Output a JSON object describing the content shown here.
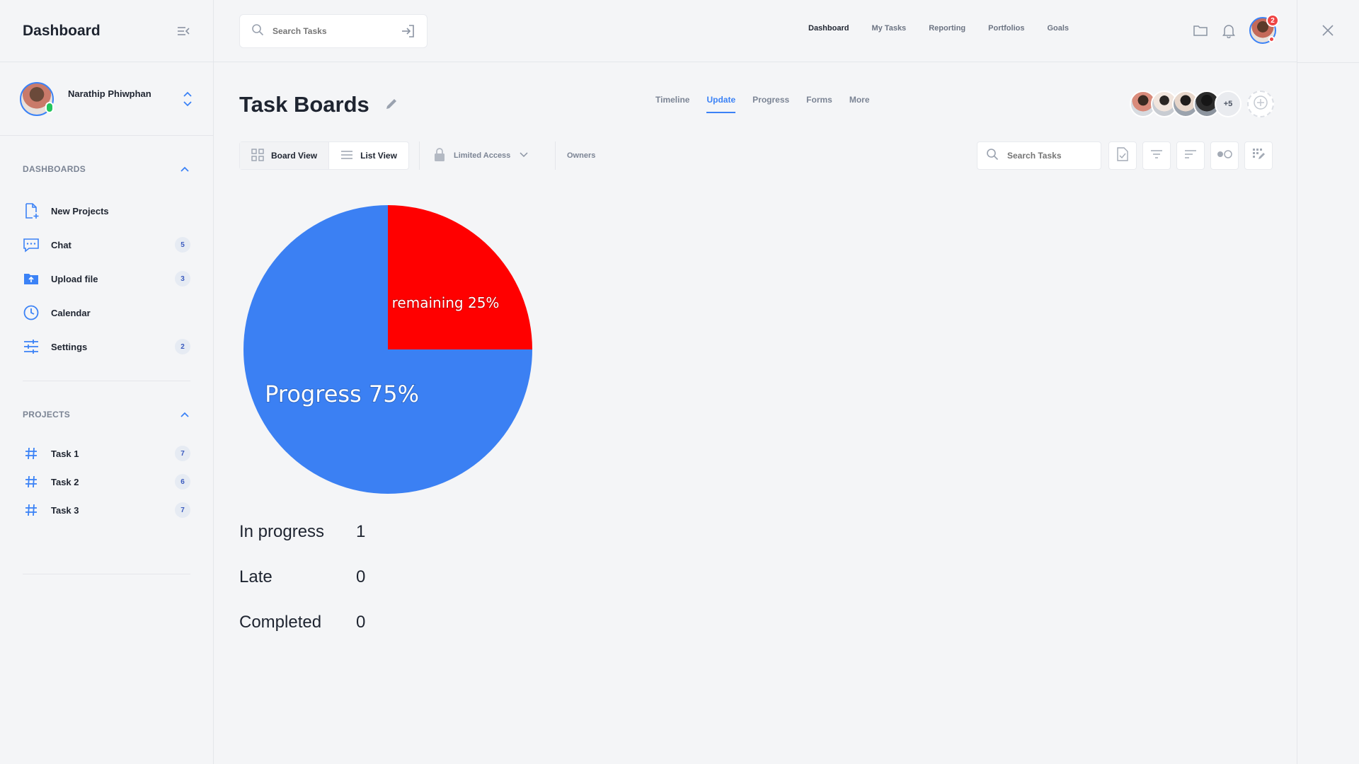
{
  "sidebar": {
    "title": "Dashboard",
    "user": {
      "name": "Narathip Phiwphan"
    },
    "dashboards": {
      "title": "DASHBOARDS",
      "items": [
        {
          "label": "New Projects",
          "badge": ""
        },
        {
          "label": "Chat",
          "badge": "5"
        },
        {
          "label": "Upload file",
          "badge": "3"
        },
        {
          "label": "Calendar",
          "badge": ""
        },
        {
          "label": "Settings",
          "badge": "2"
        }
      ]
    },
    "projects": {
      "title": "PROJECTS",
      "items": [
        {
          "label": "Task 1",
          "badge": "7"
        },
        {
          "label": "Task 2",
          "badge": "6"
        },
        {
          "label": "Task 3",
          "badge": "7"
        }
      ]
    }
  },
  "topbar": {
    "search_placeholder": "Search Tasks",
    "nav": [
      "Dashboard",
      "My Tasks",
      "Reporting",
      "Portfolios",
      "Goals"
    ],
    "notification_count": "2"
  },
  "main": {
    "title": "Task Boards",
    "tabs": [
      "Timeline",
      "Update",
      "Progress",
      "Forms",
      "More"
    ],
    "active_tab": "Update",
    "members_more": "+5",
    "toolbar": {
      "board_view": "Board View",
      "list_view": "List View",
      "access": "Limited Access",
      "owners": "Owners",
      "search_placeholder": "Search Tasks"
    },
    "stats": [
      {
        "label": "In progress",
        "value": "1"
      },
      {
        "label": "Late",
        "value": "0"
      },
      {
        "label": "Completed",
        "value": "0"
      }
    ]
  },
  "colors": {
    "accent": "#3b82f6",
    "progress": "#3b80f3",
    "remaining": "#ff0000"
  },
  "chart_data": {
    "type": "pie",
    "slices": [
      {
        "label": "remaining 25%",
        "value": 25,
        "color": "#ff0000"
      },
      {
        "label": "Progress 75%",
        "value": 75,
        "color": "#3b80f3"
      }
    ]
  }
}
